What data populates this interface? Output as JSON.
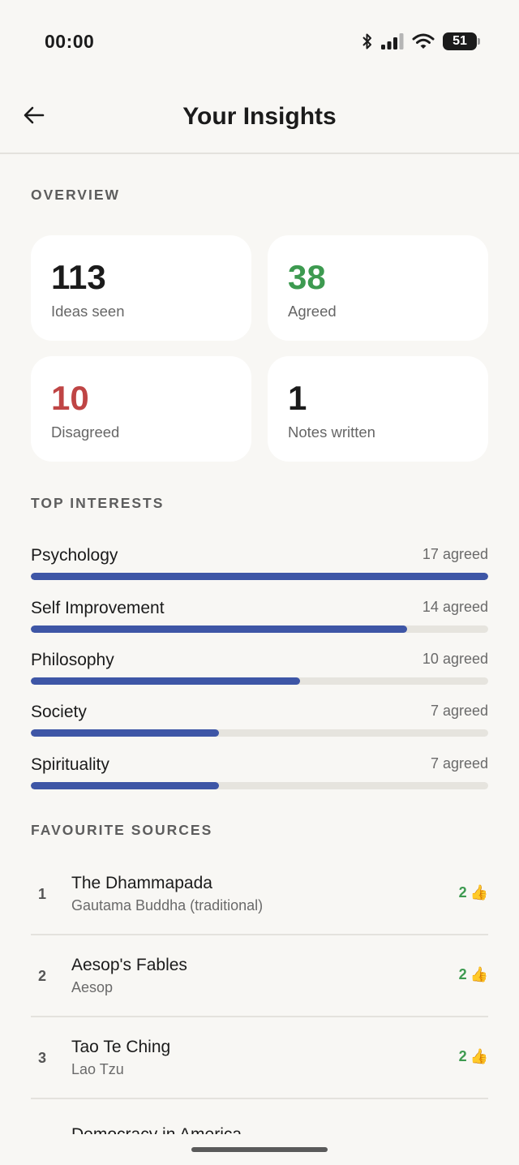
{
  "status_bar": {
    "time": "00:00",
    "battery": "51"
  },
  "header": {
    "title": "Your Insights"
  },
  "overview": {
    "label": "OVERVIEW",
    "stats": [
      {
        "value": "113",
        "label": "Ideas seen",
        "color": "#1b1b1b"
      },
      {
        "value": "38",
        "label": "Agreed",
        "color": "#3d9a50"
      },
      {
        "value": "10",
        "label": "Disagreed",
        "color": "#bf4545"
      },
      {
        "value": "1",
        "label": "Notes written",
        "color": "#1b1b1b"
      }
    ]
  },
  "top_interests": {
    "label": "TOP INTERESTS",
    "items": [
      {
        "name": "Psychology",
        "count": "17 agreed",
        "agreed": 17
      },
      {
        "name": "Self Improvement",
        "count": "14 agreed",
        "agreed": 14
      },
      {
        "name": "Philosophy",
        "count": "10 agreed",
        "agreed": 10
      },
      {
        "name": "Society",
        "count": "7 agreed",
        "agreed": 7
      },
      {
        "name": "Spirituality",
        "count": "7 agreed",
        "agreed": 7
      }
    ]
  },
  "favourite_sources": {
    "label": "FAVOURITE SOURCES",
    "items": [
      {
        "rank": "1",
        "title": "The Dhammapada",
        "author": "Gautama Buddha (traditional)",
        "likes": "2"
      },
      {
        "rank": "2",
        "title": "Aesop's Fables",
        "author": "Aesop",
        "likes": "2"
      },
      {
        "rank": "3",
        "title": "Tao Te Ching",
        "author": "Lao Tzu",
        "likes": "2"
      }
    ],
    "partial_next_title": "Democracy in America"
  },
  "colors": {
    "accent": "#3e56a6",
    "agree": "#3d9a50",
    "disagree": "#bf4545",
    "track": "#e6e4de"
  },
  "icons": {
    "back": "arrow-left-icon",
    "like": "thumbs-up-icon"
  }
}
